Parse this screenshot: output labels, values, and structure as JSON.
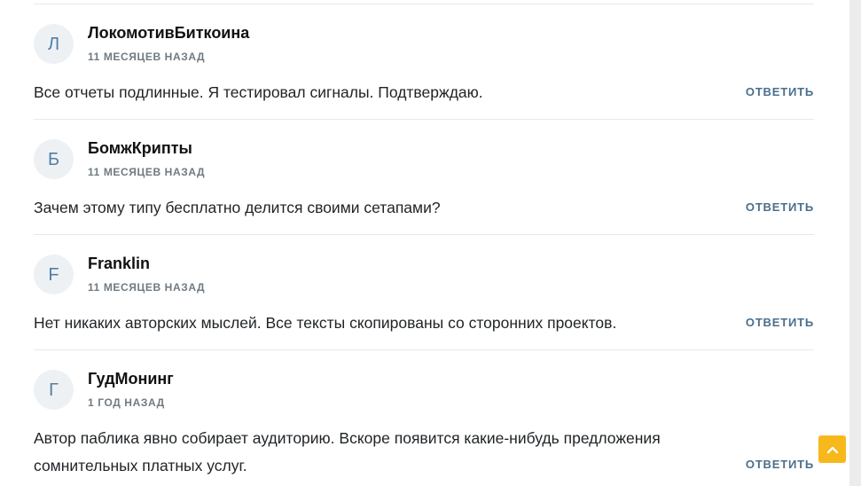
{
  "comments": [
    {
      "avatar_letter": "Л",
      "author": "ЛокомотивБиткоина",
      "date": "11 МЕСЯЦЕВ НАЗАД",
      "text": "Все отчеты подлинные. Я тестировал сигналы. Подтверждаю.",
      "reply_label": "ОТВЕТИТЬ"
    },
    {
      "avatar_letter": "Б",
      "author": "БомжКрипты",
      "date": "11 МЕСЯЦЕВ НАЗАД",
      "text": "Зачем этому типу бесплатно делится своими сетапами?",
      "reply_label": "ОТВЕТИТЬ"
    },
    {
      "avatar_letter": "F",
      "author": "Franklin",
      "date": "11 МЕСЯЦЕВ НАЗАД",
      "text": "Нет никаких авторских мыслей. Все тексты скопированы со сторонних проектов.",
      "reply_label": "ОТВЕТИТЬ"
    },
    {
      "avatar_letter": "Г",
      "author": "ГудМонинг",
      "date": "1 ГОД НАЗАД",
      "text": "Автор паблика явно собирает аудиторию. Вскоре появится какие-нибудь предложения сомнительных платных услуг.",
      "reply_label": "ОТВЕТИТЬ"
    }
  ],
  "scroll_top_button": {
    "icon": "chevron-up-icon",
    "color": "#f7b81c"
  },
  "colors": {
    "avatar_bg": "#eef1f4",
    "avatar_letter": "#4f7fa7",
    "reply_link": "#4a6f8c",
    "date_text": "#6f7a82"
  }
}
